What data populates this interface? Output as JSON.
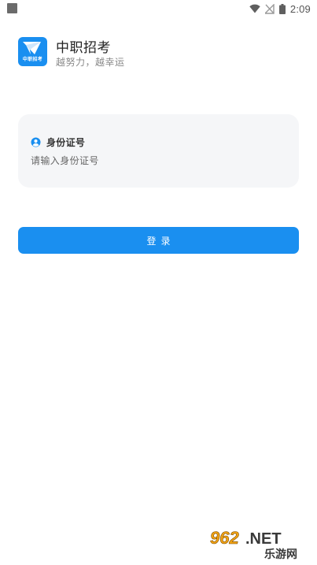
{
  "status_bar": {
    "time": "2:09",
    "icons": [
      "wifi-icon",
      "no-signal-icon",
      "battery-icon"
    ]
  },
  "header": {
    "logo_text": "中职招考",
    "app_name": "中职招考",
    "slogan": "越努力，越幸运"
  },
  "form": {
    "id_label": "身份证号",
    "id_placeholder": "请输入身份证号",
    "id_value": ""
  },
  "login": {
    "label": "登录"
  },
  "watermark": {
    "brand": "962.NET",
    "site_name": "乐游网"
  },
  "colors": {
    "accent": "#1a8ff0",
    "field_background": "#f5f6f8",
    "slogan": "#888888"
  }
}
